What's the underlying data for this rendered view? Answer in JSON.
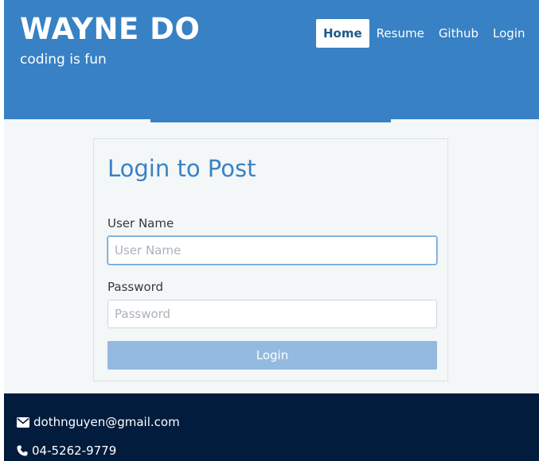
{
  "header": {
    "title": "WAYNE DO",
    "subtitle": "coding is fun",
    "nav": [
      {
        "label": "Home",
        "active": true
      },
      {
        "label": "Resume",
        "active": false
      },
      {
        "label": "Github",
        "active": false
      },
      {
        "label": "Login",
        "active": false
      }
    ]
  },
  "login_form": {
    "title": "Login to Post",
    "username_label": "User Name",
    "username_placeholder": "User Name",
    "username_value": "",
    "password_label": "Password",
    "password_placeholder": "Password",
    "password_value": "",
    "submit_label": "Login"
  },
  "footer": {
    "email": "dothnguyen@gmail.com",
    "email_icon": "envelope-icon",
    "phone": "04-5262-9779",
    "phone_icon": "phone-icon"
  },
  "colors": {
    "header_bg": "#3781c4",
    "footer_bg": "#011c3d",
    "title_color": "#3a82c4",
    "button_bg": "#94bae0"
  }
}
